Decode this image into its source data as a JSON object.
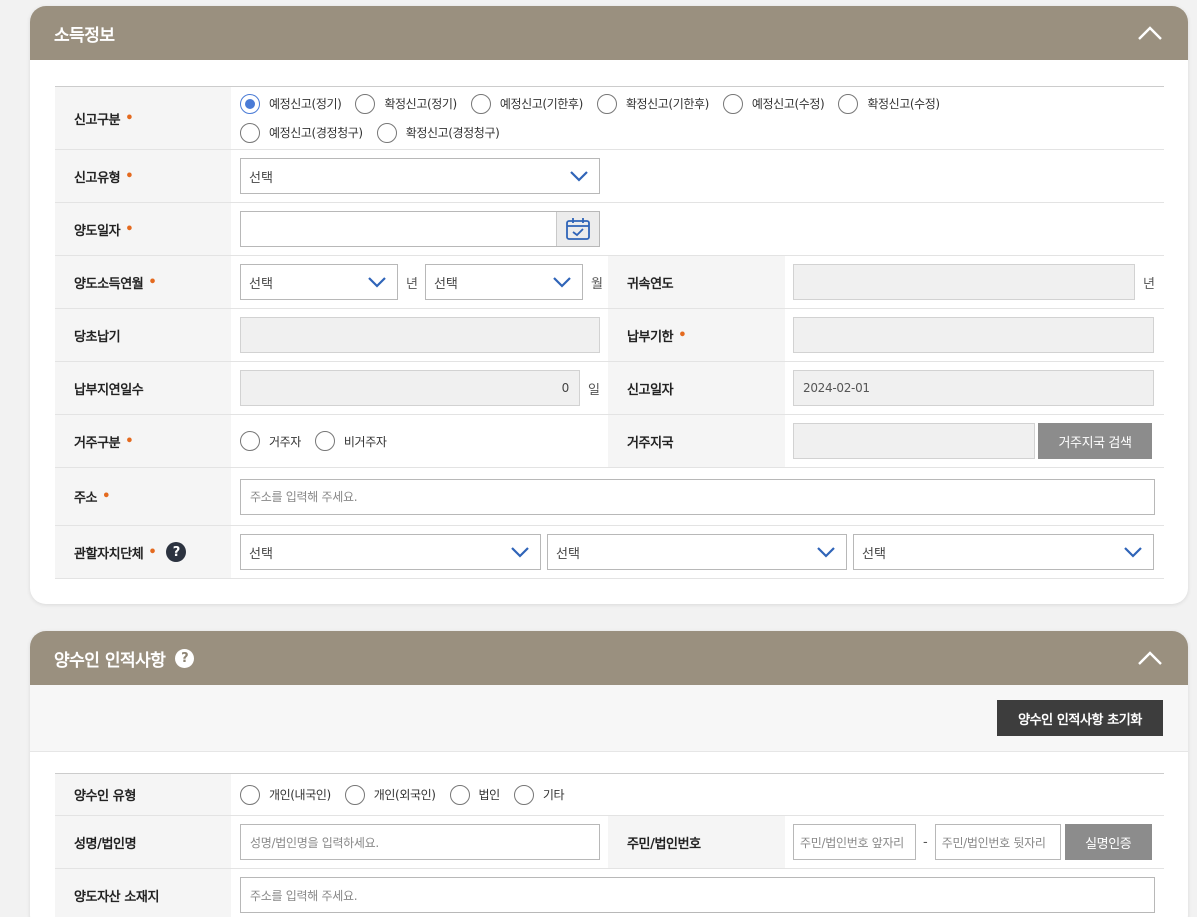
{
  "income": {
    "title": "소득정보",
    "report_division": {
      "label": "신고구분",
      "options": [
        "예정신고(정기)",
        "확정신고(정기)",
        "예정신고(기한후)",
        "확정신고(기한후)",
        "예정신고(수정)",
        "확정신고(수정)",
        "예정신고(경정청구)",
        "확정신고(경정청구)"
      ],
      "selected": "예정신고(정기)"
    },
    "report_type": {
      "label": "신고유형",
      "value": "선택"
    },
    "transfer_date": {
      "label": "양도일자",
      "value": ""
    },
    "transfer_income_month": {
      "label": "양도소득연월",
      "year_value": "선택",
      "year_unit": "년",
      "month_value": "선택",
      "month_unit": "월"
    },
    "attribution_year": {
      "label": "귀속연도",
      "value": "",
      "unit": "년"
    },
    "initial_payment": {
      "label": "당초납기",
      "value": ""
    },
    "payment_due": {
      "label": "납부기한",
      "value": ""
    },
    "late_days": {
      "label": "납부지연일수",
      "value": "0",
      "unit": "일"
    },
    "report_date": {
      "label": "신고일자",
      "value": "2024-02-01"
    },
    "residence": {
      "label": "거주구분",
      "options": [
        "거주자",
        "비거주자"
      ]
    },
    "residence_country": {
      "label": "거주지국",
      "value": "",
      "search_button": "거주지국 검색"
    },
    "address": {
      "label": "주소",
      "placeholder": "주소를 입력해 주세요."
    },
    "jurisdiction": {
      "label": "관할자치단체",
      "help": "?",
      "selects": [
        "선택",
        "선택",
        "선택"
      ]
    }
  },
  "transferee": {
    "title": "양수인 인적사항",
    "help": "?",
    "reset_button": "양수인 인적사항 초기화",
    "type": {
      "label": "양수인 유형",
      "options": [
        "개인(내국인)",
        "개인(외국인)",
        "법인",
        "기타"
      ]
    },
    "name": {
      "label": "성명/법인명",
      "placeholder": "성명/법인명을 입력하세요."
    },
    "reg_number": {
      "label": "주민/법인번호",
      "front_placeholder": "주민/법인번호 앞자리",
      "separator": "-",
      "back_placeholder": "주민/법인번호 뒷자리",
      "verify_button": "실명인증"
    },
    "asset_location": {
      "label": "양도자산 소재지",
      "placeholder": "주소를 입력해 주세요."
    }
  },
  "required_mark": "•",
  "colors": {
    "header": "#9a907f",
    "required": "#e46a1f",
    "radio_on": "#4a7bd6",
    "dark_button": "#3d3d3d",
    "gray_button": "#8c8c8c"
  }
}
